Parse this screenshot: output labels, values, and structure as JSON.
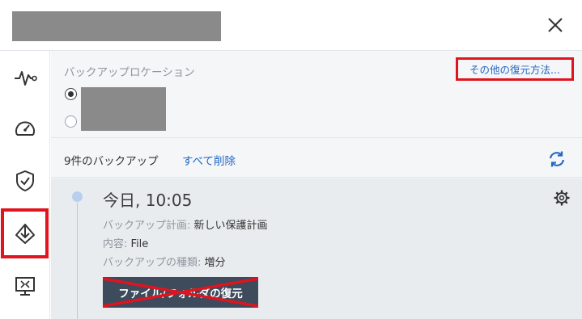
{
  "header": {
    "close_icon": "close-icon"
  },
  "sidebar": {
    "items": [
      {
        "icon": "activity-icon",
        "active": false
      },
      {
        "icon": "dashboard-gauge-icon",
        "active": false
      },
      {
        "icon": "shield-check-icon",
        "active": false
      },
      {
        "icon": "recovery-icon",
        "active": true
      },
      {
        "icon": "remote-desktop-icon",
        "active": false
      }
    ]
  },
  "location": {
    "label": "バックアップロケーション",
    "other_methods": "その他の復元方法...",
    "options": [
      {
        "selected": true
      },
      {
        "selected": false
      }
    ]
  },
  "backups": {
    "count_label": "9件のバックアップ",
    "delete_all": "すべて削除",
    "refresh_icon": "refresh-icon"
  },
  "entry": {
    "time": "今日, 10:05",
    "plan_key": "バックアップ計画:",
    "plan_value": "新しい保護計画",
    "content_key": "内容:",
    "content_value": "File",
    "type_key": "バックアップの種類:",
    "type_value": "増分",
    "restore_button": "ファイル/フォルダの復元"
  },
  "colors": {
    "accent": "#2468c4",
    "highlight_red": "#e0141e",
    "button_dark": "#3d4b5c"
  }
}
